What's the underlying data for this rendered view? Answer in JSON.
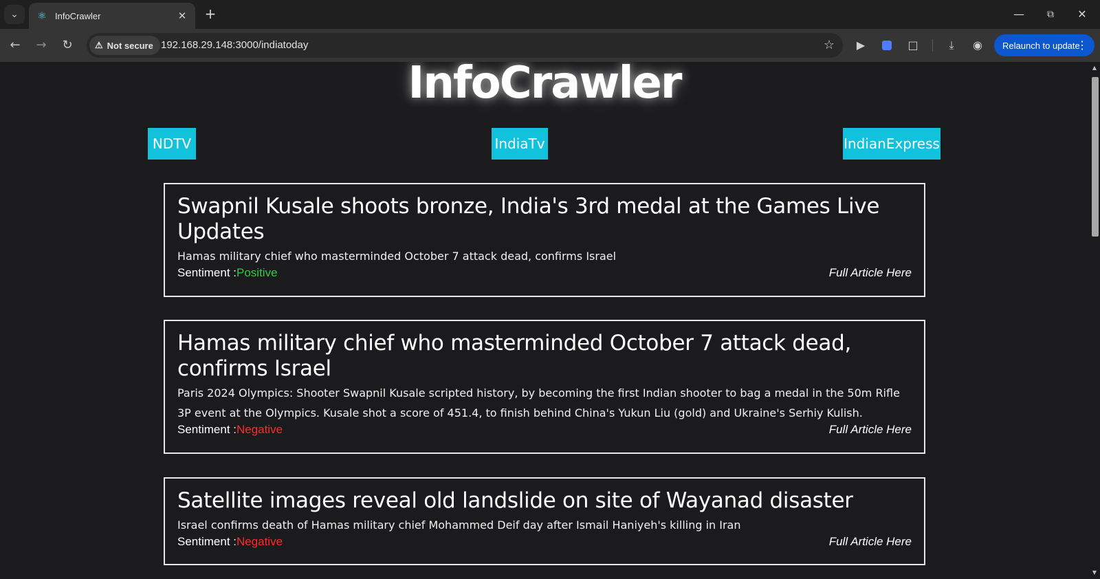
{
  "browser": {
    "tab_title": "InfoCrawler",
    "security_label": "Not secure",
    "url": "192.168.29.148:3000/indiatoday",
    "relaunch_label": "Relaunch to update"
  },
  "page": {
    "brand": "InfoCrawler",
    "sources": [
      "NDTV",
      "IndiaTv",
      "IndianExpress"
    ],
    "articles": [
      {
        "title": "Swapnil Kusale shoots bronze, India's 3rd medal at the Games Live Updates",
        "description": "Hamas military chief who masterminded October 7 attack dead, confirms Israel",
        "sentiment_label": "Sentiment :",
        "sentiment": "Positive",
        "link_label": "Full Article Here"
      },
      {
        "title": "Hamas military chief who masterminded October 7 attack dead, confirms Israel",
        "description": "Paris 2024 Olympics: Shooter Swapnil Kusale scripted history, by becoming the first Indian shooter to bag a medal in the 50m Rifle 3P event at the Olympics. Kusale shot a score of 451.4, to finish behind China's Yukun Liu (gold) and Ukraine's Serhiy Kulish.",
        "sentiment_label": "Sentiment :",
        "sentiment": "Negative",
        "link_label": "Full Article Here"
      },
      {
        "title": "Satellite images reveal old landslide on site of Wayanad disaster",
        "description": "Israel confirms death of Hamas military chief Mohammed Deif day after Ismail Haniyeh's killing in Iran",
        "sentiment_label": "Sentiment :",
        "sentiment": "Negative",
        "link_label": "Full Article Here"
      }
    ]
  },
  "colors": {
    "page_bg": "#1b1b1d",
    "source_button": "#12c2dd",
    "positive": "#2ecc40",
    "negative": "#ff2a2a",
    "relaunch": "#0b57d0"
  }
}
